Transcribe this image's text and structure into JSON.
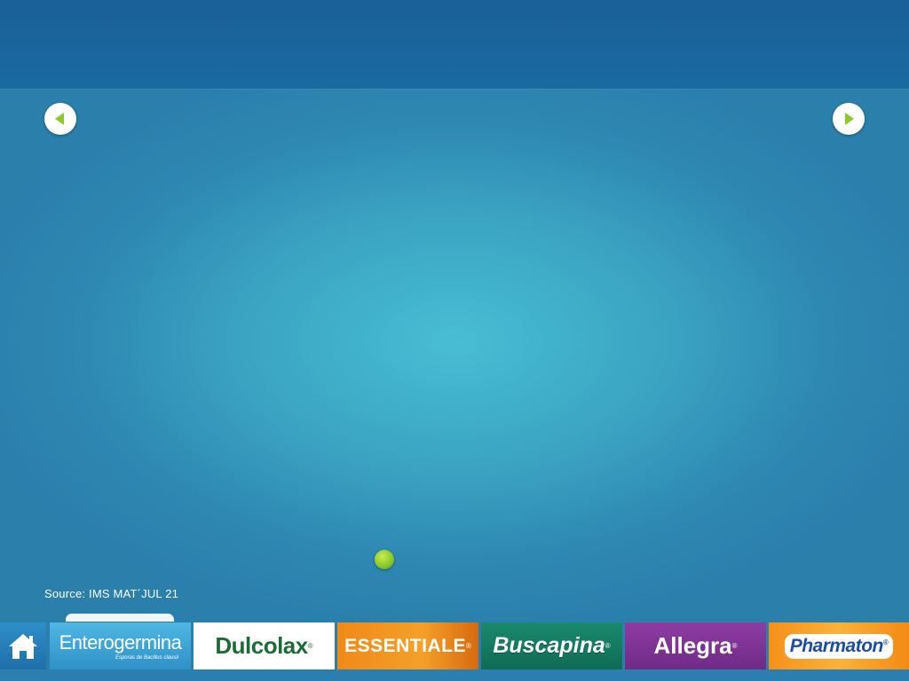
{
  "nav": {
    "prev_icon": "arrow-left-icon",
    "next_icon": "arrow-right-icon",
    "arrow_color": "#8cc928"
  },
  "footer": {
    "source_text": "Source: IMS MAT´JUL 21"
  },
  "brand_bar": {
    "home_icon": "home-icon",
    "brands": [
      {
        "name": "Enterogermina",
        "tagline": "Esporas de Bacillus clausii"
      },
      {
        "name": "Dulcolax"
      },
      {
        "name": "ESSENTIALE"
      },
      {
        "name": "Buscapina"
      },
      {
        "name": "Allegra"
      },
      {
        "name": "Pharmaton"
      }
    ],
    "registered_mark": "®"
  },
  "colors": {
    "background_center": "#48bed3",
    "background_edge": "#2a7fab",
    "top_bar": "#1a62a0",
    "dulcolax_green": "#1b6b35",
    "essentiale_orange": "#f08a18",
    "buscapina_green": "#1a8a6e",
    "allegra_purple": "#8e3da2",
    "pharmaton_blue": "#1a4e9e"
  }
}
